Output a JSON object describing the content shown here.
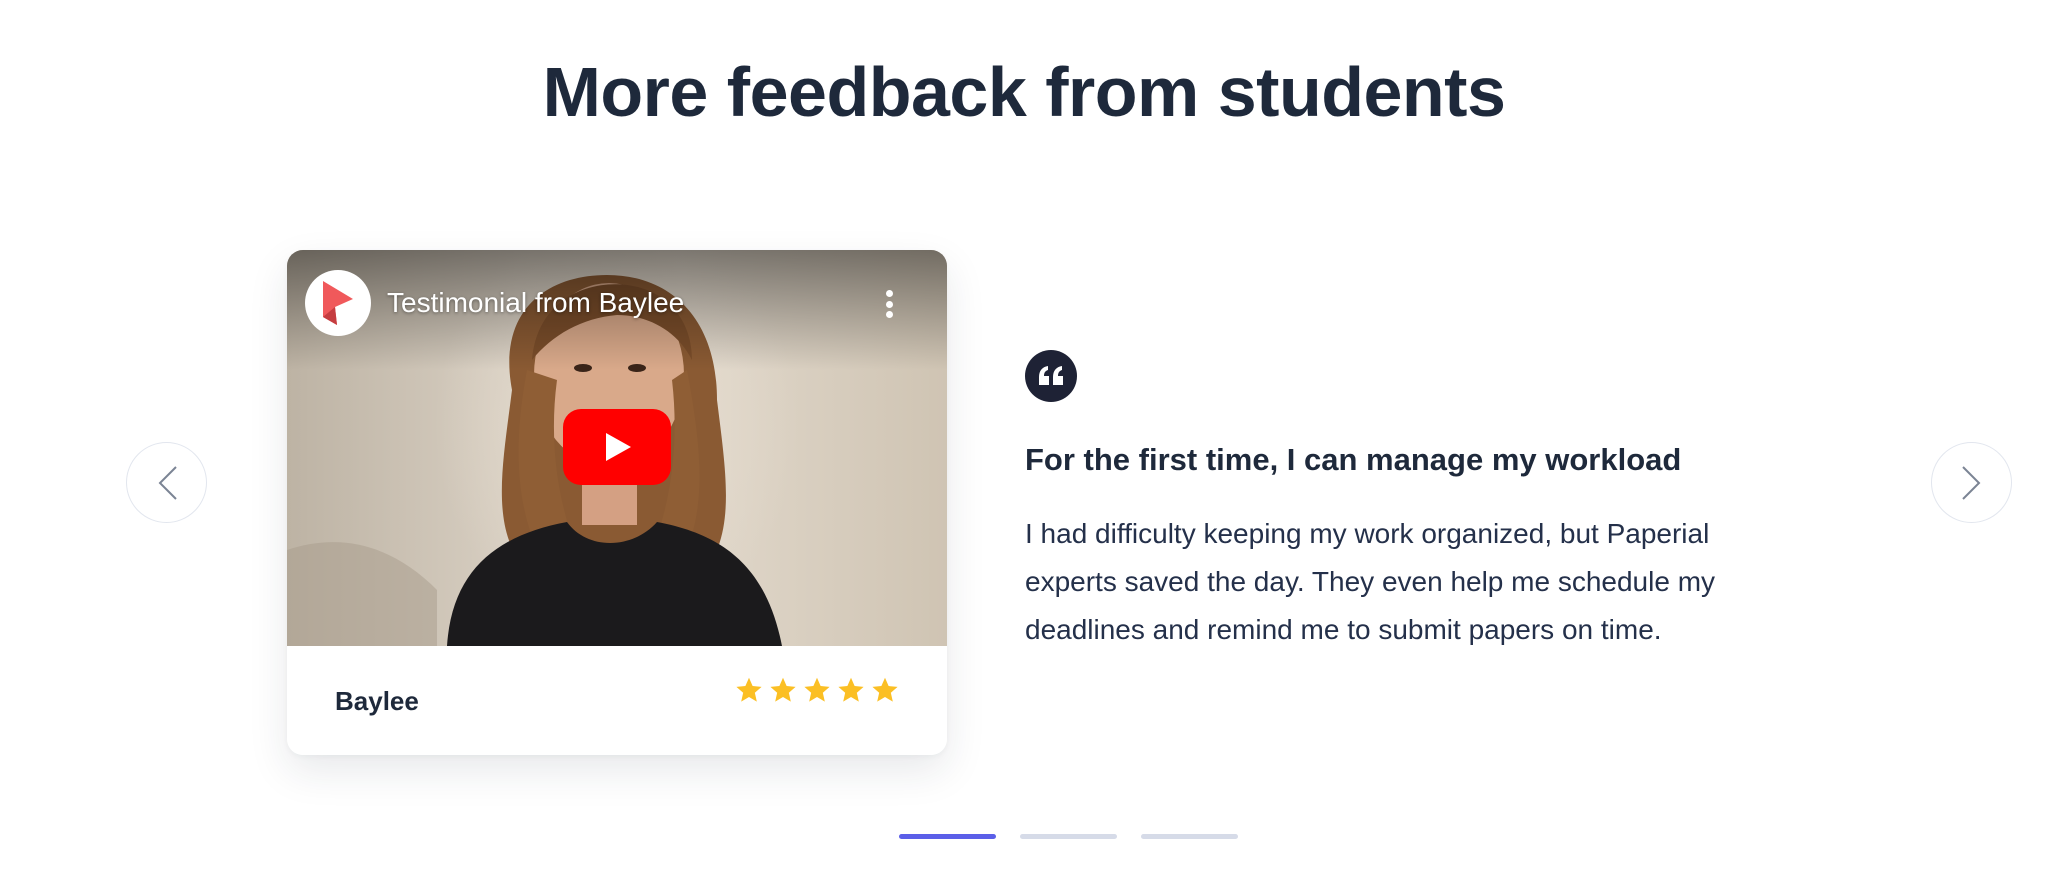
{
  "section": {
    "title": "More feedback from students"
  },
  "navigation": {
    "prev_icon": "chevron-left-icon",
    "next_icon": "chevron-right-icon"
  },
  "video_card": {
    "video_title": "Testimonial from Baylee",
    "channel_logo_icon": "channel-logo-icon",
    "menu_icon": "more-vertical-icon",
    "play_icon": "youtube-play-icon",
    "author": "Baylee",
    "rating": {
      "value": 5,
      "max": 5,
      "color": "#fbbf24"
    }
  },
  "testimonial": {
    "quote_icon": "quote-icon",
    "heading": "For the first time, I can manage my workload",
    "body_lines": [
      "I had difficulty keeping my work organized, but Paperial",
      "experts saved the day. They even help me schedule my",
      "deadlines and remind me to submit papers on time."
    ]
  },
  "pagination": {
    "total": 3,
    "active": 1,
    "active_color": "#5b5fe8",
    "inactive_color": "#d6dbe8"
  },
  "colors": {
    "heading": "#1e293b",
    "youtube_red": "#ff0000",
    "star": "#fbbf24"
  }
}
